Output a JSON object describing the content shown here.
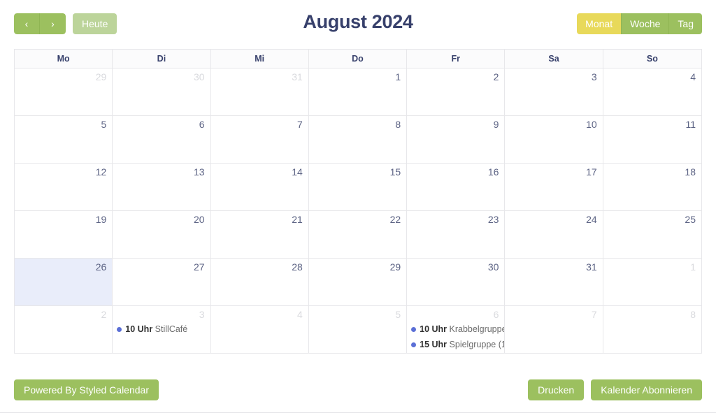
{
  "toolbar": {
    "prev_label": "‹",
    "next_label": "›",
    "today_label": "Heute",
    "title": "August 2024",
    "views": [
      {
        "label": "Monat",
        "active": true
      },
      {
        "label": "Woche",
        "active": false
      },
      {
        "label": "Tag",
        "active": false
      }
    ]
  },
  "weekdays": [
    "Mo",
    "Di",
    "Mi",
    "Do",
    "Fr",
    "Sa",
    "So"
  ],
  "weeks": [
    [
      {
        "num": "29",
        "other": true,
        "today": false,
        "events": []
      },
      {
        "num": "30",
        "other": true,
        "today": false,
        "events": []
      },
      {
        "num": "31",
        "other": true,
        "today": false,
        "events": []
      },
      {
        "num": "1",
        "other": false,
        "today": false,
        "events": []
      },
      {
        "num": "2",
        "other": false,
        "today": false,
        "events": []
      },
      {
        "num": "3",
        "other": false,
        "today": false,
        "events": []
      },
      {
        "num": "4",
        "other": false,
        "today": false,
        "events": []
      }
    ],
    [
      {
        "num": "5",
        "other": false,
        "today": false,
        "events": []
      },
      {
        "num": "6",
        "other": false,
        "today": false,
        "events": []
      },
      {
        "num": "7",
        "other": false,
        "today": false,
        "events": []
      },
      {
        "num": "8",
        "other": false,
        "today": false,
        "events": []
      },
      {
        "num": "9",
        "other": false,
        "today": false,
        "events": []
      },
      {
        "num": "10",
        "other": false,
        "today": false,
        "events": []
      },
      {
        "num": "11",
        "other": false,
        "today": false,
        "events": []
      }
    ],
    [
      {
        "num": "12",
        "other": false,
        "today": false,
        "events": []
      },
      {
        "num": "13",
        "other": false,
        "today": false,
        "events": []
      },
      {
        "num": "14",
        "other": false,
        "today": false,
        "events": []
      },
      {
        "num": "15",
        "other": false,
        "today": false,
        "events": []
      },
      {
        "num": "16",
        "other": false,
        "today": false,
        "events": []
      },
      {
        "num": "17",
        "other": false,
        "today": false,
        "events": []
      },
      {
        "num": "18",
        "other": false,
        "today": false,
        "events": []
      }
    ],
    [
      {
        "num": "19",
        "other": false,
        "today": false,
        "events": []
      },
      {
        "num": "20",
        "other": false,
        "today": false,
        "events": []
      },
      {
        "num": "21",
        "other": false,
        "today": false,
        "events": []
      },
      {
        "num": "22",
        "other": false,
        "today": false,
        "events": []
      },
      {
        "num": "23",
        "other": false,
        "today": false,
        "events": []
      },
      {
        "num": "24",
        "other": false,
        "today": false,
        "events": []
      },
      {
        "num": "25",
        "other": false,
        "today": false,
        "events": []
      }
    ],
    [
      {
        "num": "26",
        "other": false,
        "today": true,
        "events": []
      },
      {
        "num": "27",
        "other": false,
        "today": false,
        "events": []
      },
      {
        "num": "28",
        "other": false,
        "today": false,
        "events": []
      },
      {
        "num": "29",
        "other": false,
        "today": false,
        "events": []
      },
      {
        "num": "30",
        "other": false,
        "today": false,
        "events": []
      },
      {
        "num": "31",
        "other": false,
        "today": false,
        "events": []
      },
      {
        "num": "1",
        "other": true,
        "today": false,
        "events": []
      }
    ],
    [
      {
        "num": "2",
        "other": true,
        "today": false,
        "events": []
      },
      {
        "num": "3",
        "other": true,
        "today": false,
        "events": [
          {
            "time": "10 Uhr",
            "title": "StillCafé"
          }
        ]
      },
      {
        "num": "4",
        "other": true,
        "today": false,
        "events": []
      },
      {
        "num": "5",
        "other": true,
        "today": false,
        "events": []
      },
      {
        "num": "6",
        "other": true,
        "today": false,
        "events": [
          {
            "time": "10 Uhr",
            "title": "Krabbelgruppe"
          },
          {
            "time": "15 Uhr",
            "title": "Spielgruppe (1"
          }
        ]
      },
      {
        "num": "7",
        "other": true,
        "today": false,
        "events": []
      },
      {
        "num": "8",
        "other": true,
        "today": false,
        "events": []
      }
    ]
  ],
  "footer": {
    "powered_label": "Powered By Styled Calendar",
    "print_label": "Drucken",
    "subscribe_label": "Kalender Abonnieren"
  },
  "colors": {
    "green": "#9cc05f",
    "green_light": "#bcd49a",
    "yellow_active": "#e8d95a",
    "title_navy": "#37406b",
    "today_bg": "#e9edfa",
    "event_dot": "#5b6fd6",
    "grid_border": "#e7e7ea"
  }
}
